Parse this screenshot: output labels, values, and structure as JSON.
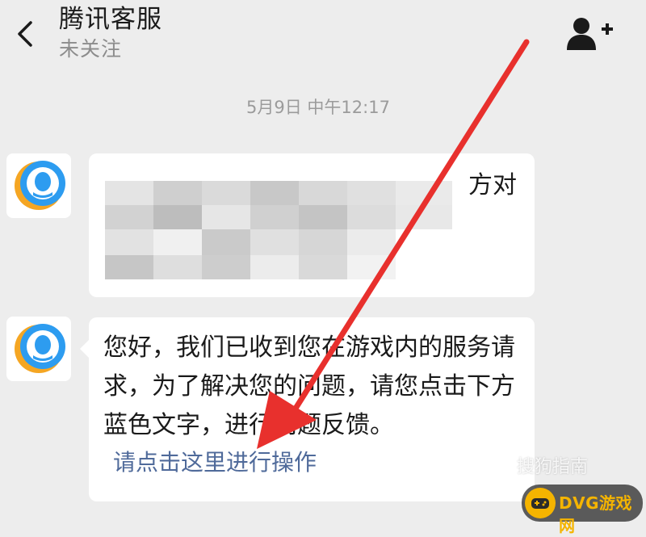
{
  "header": {
    "title": "腾讯客服",
    "subtitle": "未关注",
    "back_icon": "chevron-left-icon",
    "add_friend_icon": "add-user-icon"
  },
  "chat": {
    "timestamp": "5月9日 中午12:17",
    "messages": [
      {
        "sender": "腾讯客服",
        "avatar_icon": "qq-customer-service-icon",
        "visible_text": "方对",
        "obscured": true
      },
      {
        "sender": "腾讯客服",
        "avatar_icon": "qq-customer-service-icon",
        "text": "您好，我们已收到您在游戏内的服务请求，为了解决您的问题，请您点击下方蓝色文字，进行问题反馈。",
        "link": "请点击这里进行操作"
      }
    ]
  },
  "overlay": {
    "arrow_color": "#e8302d",
    "watermark_sogou": "搜狗指南",
    "watermark_logo": "DVG游戏网"
  },
  "colors": {
    "background": "#ededed",
    "bubble": "#ffffff",
    "link": "#4f6a9a",
    "timestamp": "#9b9b9b"
  }
}
